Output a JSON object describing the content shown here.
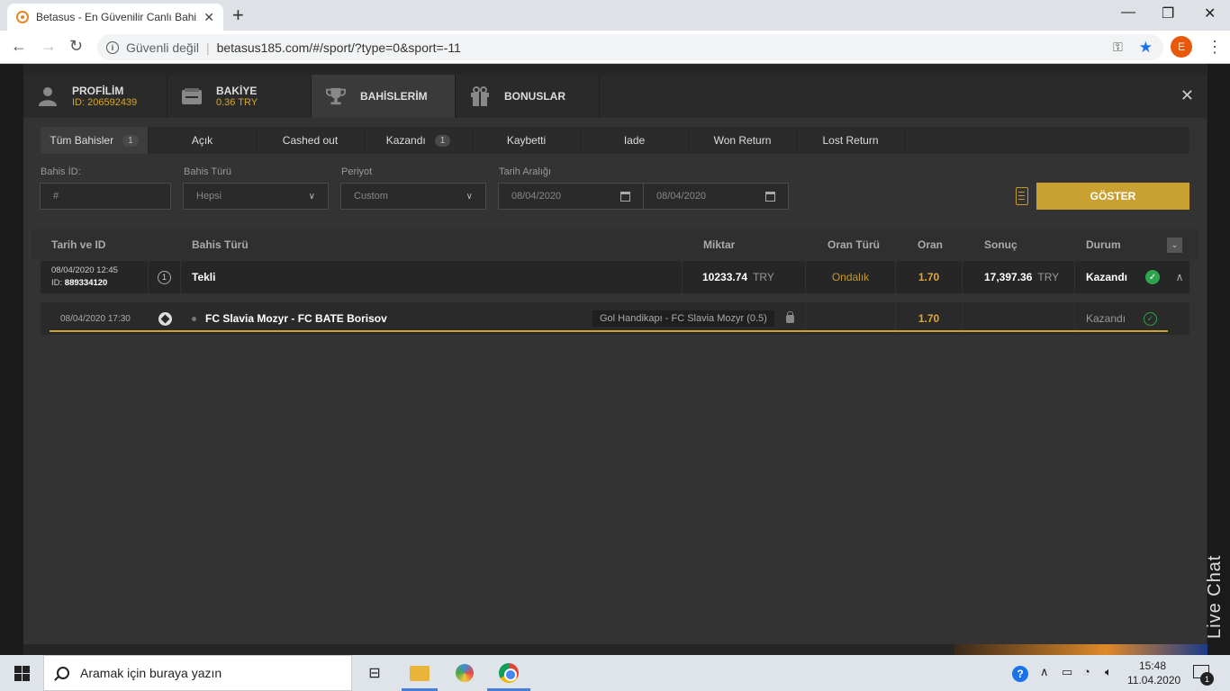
{
  "browser": {
    "tab_title": "Betasus - En Güvenilir Canlı Bahis",
    "security_label": "Güvenli değil",
    "url": "betasus185.com/#/sport/?type=0&sport=-11",
    "profile_initial": "E"
  },
  "modal": {
    "tabs": [
      {
        "label": "PROFİLİM",
        "sub": "ID: 206592439",
        "icon": "user-icon"
      },
      {
        "label": "BAKİYE",
        "sub": "0.36 TRY",
        "icon": "wallet-icon"
      },
      {
        "label": "BAHİSLERİM",
        "sub": "",
        "icon": "trophy-icon"
      },
      {
        "label": "BONUSLAR",
        "sub": "",
        "icon": "gift-icon"
      }
    ],
    "active_tab": "BAHİSLERİM",
    "filter_tabs": [
      {
        "label": "Tüm Bahisler",
        "count": "1"
      },
      {
        "label": "Açık",
        "count": ""
      },
      {
        "label": "Cashed out",
        "count": ""
      },
      {
        "label": "Kazandı",
        "count": "1"
      },
      {
        "label": "Kaybetti",
        "count": ""
      },
      {
        "label": "Iade",
        "count": ""
      },
      {
        "label": "Won Return",
        "count": ""
      },
      {
        "label": "Lost Return",
        "count": ""
      }
    ],
    "filters": {
      "bet_id_label": "Bahis İD:",
      "bet_id_placeholder": "#",
      "bet_type_label": "Bahis Türü",
      "bet_type_value": "Hepsi",
      "period_label": "Periyot",
      "period_value": "Custom",
      "date_range_label": "Tarih Aralığı",
      "date_from": "08/04/2020",
      "date_to": "08/04/2020",
      "show_button": "GÖSTER"
    },
    "table": {
      "headers": {
        "date_id": "Tarih ve ID",
        "bet_type": "Bahis Türü",
        "amount": "Miktar",
        "odds_type": "Oran Türü",
        "odds": "Oran",
        "result": "Sonuç",
        "status": "Durum"
      },
      "bet": {
        "datetime": "08/04/2020 12:45",
        "id_prefix": "ID:",
        "id": "889334120",
        "count": "1",
        "type": "Tekli",
        "amount": "10233.74",
        "amount_currency": "TRY",
        "odds_type": "Ondalık",
        "odds": "1.70",
        "result": "17,397.36",
        "result_currency": "TRY",
        "status": "Kazandı"
      },
      "event": {
        "datetime": "08/04/2020 17:30",
        "match": "FC Slavia Mozyr - FC BATE Borisov",
        "market": "Gol Handikapı - FC Slavia Mozyr (0.5)",
        "odds": "1.70",
        "status": "Kazandı"
      }
    }
  },
  "side": {
    "live_chat": "Live Chat"
  },
  "taskbar": {
    "search_placeholder": "Aramak için buraya yazın",
    "time": "15:48",
    "date": "11.04.2020",
    "notification_count": "1"
  }
}
